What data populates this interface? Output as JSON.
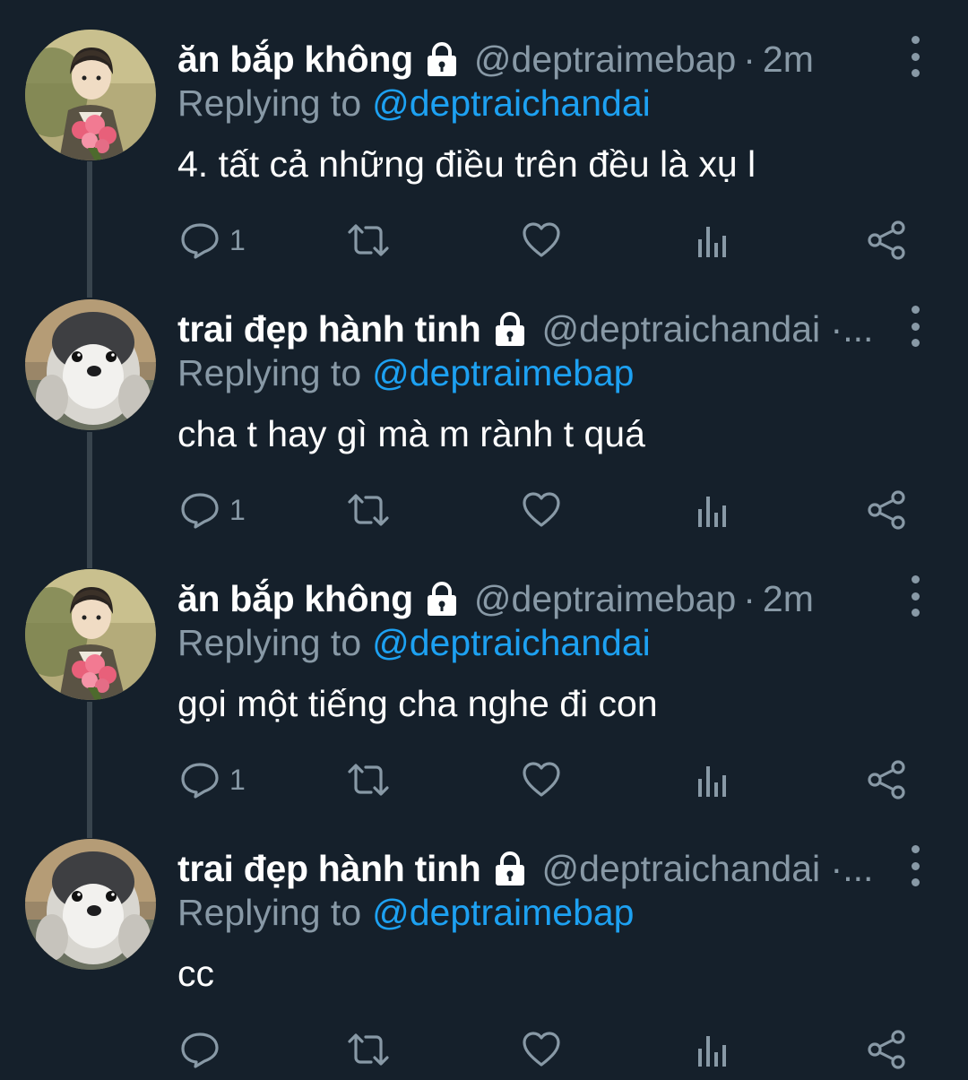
{
  "reply_prefix": "Replying to",
  "users": {
    "levi": {
      "display_name": "ăn bắp không",
      "handle": "@deptraimebap",
      "time": "2m"
    },
    "penguin": {
      "display_name": "trai đẹp hành tinh",
      "handle": "@deptraichandai ·..."
    }
  },
  "tweets": [
    {
      "display_name": "ăn bắp không",
      "handle": "@deptraimebap",
      "separator": "·",
      "time": "2m",
      "reply_to": "@deptraichandai",
      "text": "4. tất cả những điều trên đều là xụ l",
      "reply_count": "1"
    },
    {
      "display_name": "trai đẹp hành tinh",
      "handle": "@deptraichandai ·...",
      "separator": "",
      "time": "",
      "reply_to": "@deptraimebap",
      "text": "cha t hay gì mà m rành t quá",
      "reply_count": "1"
    },
    {
      "display_name": "ăn bắp không",
      "handle": "@deptraimebap",
      "separator": "·",
      "time": "2m",
      "reply_to": "@deptraichandai",
      "text": "gọi một tiếng cha nghe đi con",
      "reply_count": "1"
    },
    {
      "display_name": "trai đẹp hành tinh",
      "handle": "@deptraichandai ·...",
      "separator": "",
      "time": "",
      "reply_to": "@deptraimebap",
      "text": "cc",
      "reply_count": ""
    }
  ],
  "icons": {
    "lock": "lock-icon",
    "more": "more-vertical-icon",
    "reply": "reply-icon",
    "retweet": "retweet-icon",
    "like": "heart-icon",
    "analytics": "analytics-icon",
    "share": "share-icon"
  },
  "colors": {
    "background": "#15202b",
    "muted": "#8899a6",
    "link": "#1da1f2",
    "text": "#ffffff",
    "thread_line": "#38444d"
  }
}
